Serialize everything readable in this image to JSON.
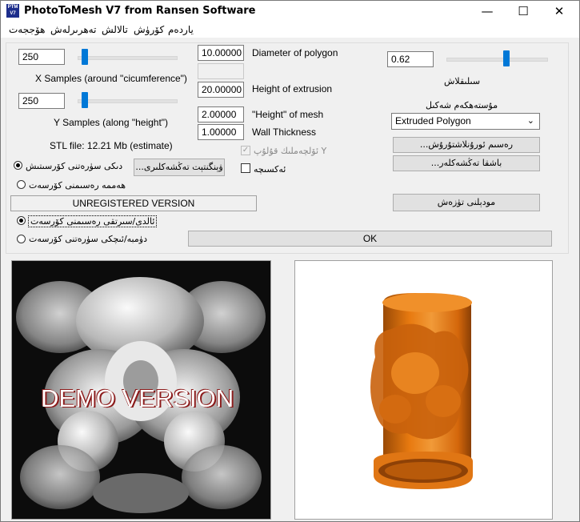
{
  "window": {
    "title": "PhotoToMesh V7 from Ransen Software",
    "icon_text": "PTM V7"
  },
  "controls": {
    "minimize": "—",
    "maximize": "☐",
    "close": "✕"
  },
  "menu": [
    "ھۆججەت",
    "تەھرىرلەش",
    "تالالش",
    "كۆرۈش",
    "ياردەم"
  ],
  "x_samples": {
    "value": "250",
    "label": "X Samples (around \"cicumference\")",
    "slider_fraction": 0.07
  },
  "y_samples": {
    "value": "250",
    "label": "Y Samples (along \"height\")",
    "slider_fraction": 0.07
  },
  "stl_file": "STL file: 12.21 Mb (estimate)",
  "diameter": {
    "value": "10.00000",
    "label": "Diameter of polygon"
  },
  "extrusion": {
    "value": "20.00000",
    "label": "Height of extrusion"
  },
  "mesh_height": {
    "value": "2.00000",
    "label": "\"Height\" of mesh"
  },
  "wall": {
    "value": "1.00000",
    "label": "Wall Thickness"
  },
  "smoothing": {
    "value": "0.62",
    "label": "سىلىقلاش",
    "slider_fraction": 0.6
  },
  "shape": {
    "label": "مۇستەھكەم شەكىل",
    "selected": "Extruded Polygon"
  },
  "auto_y": {
    "label": "ئۆلچەملىك قۇلۇپ Y",
    "mark": "✓"
  },
  "mirror": {
    "label": "ئەكسىچە"
  },
  "color_image": {
    "label": "دىكى سۈرەتنى كۆرسىتىش",
    "button": "...ۋېنگنتېت تەڭشەكلىرى"
  },
  "show_all": {
    "label": "ھەممە رەسىمنى كۆرسەت"
  },
  "unregistered": "UNREGISTERED VERSION",
  "normal_view": {
    "label": "ئالدى/سىرتقى رەسىمنى كۆرسەت"
  },
  "back_view": {
    "label": "دۈمبە/ئىچكى سۈرەتنى كۆرسەت"
  },
  "btn_rendering": "...رەسىم ئورۇنلاشتۇرۇش",
  "btn_other": "...باشقا تەڭشەكلەر",
  "btn_make": "مودېلنى تۈزەش",
  "btn_ok": "OK",
  "demo_text": "DEMO VERSION",
  "colors": {
    "accent": "#0078d7",
    "mesh_orange": "#e87a10",
    "photo_bg": "#111111"
  }
}
